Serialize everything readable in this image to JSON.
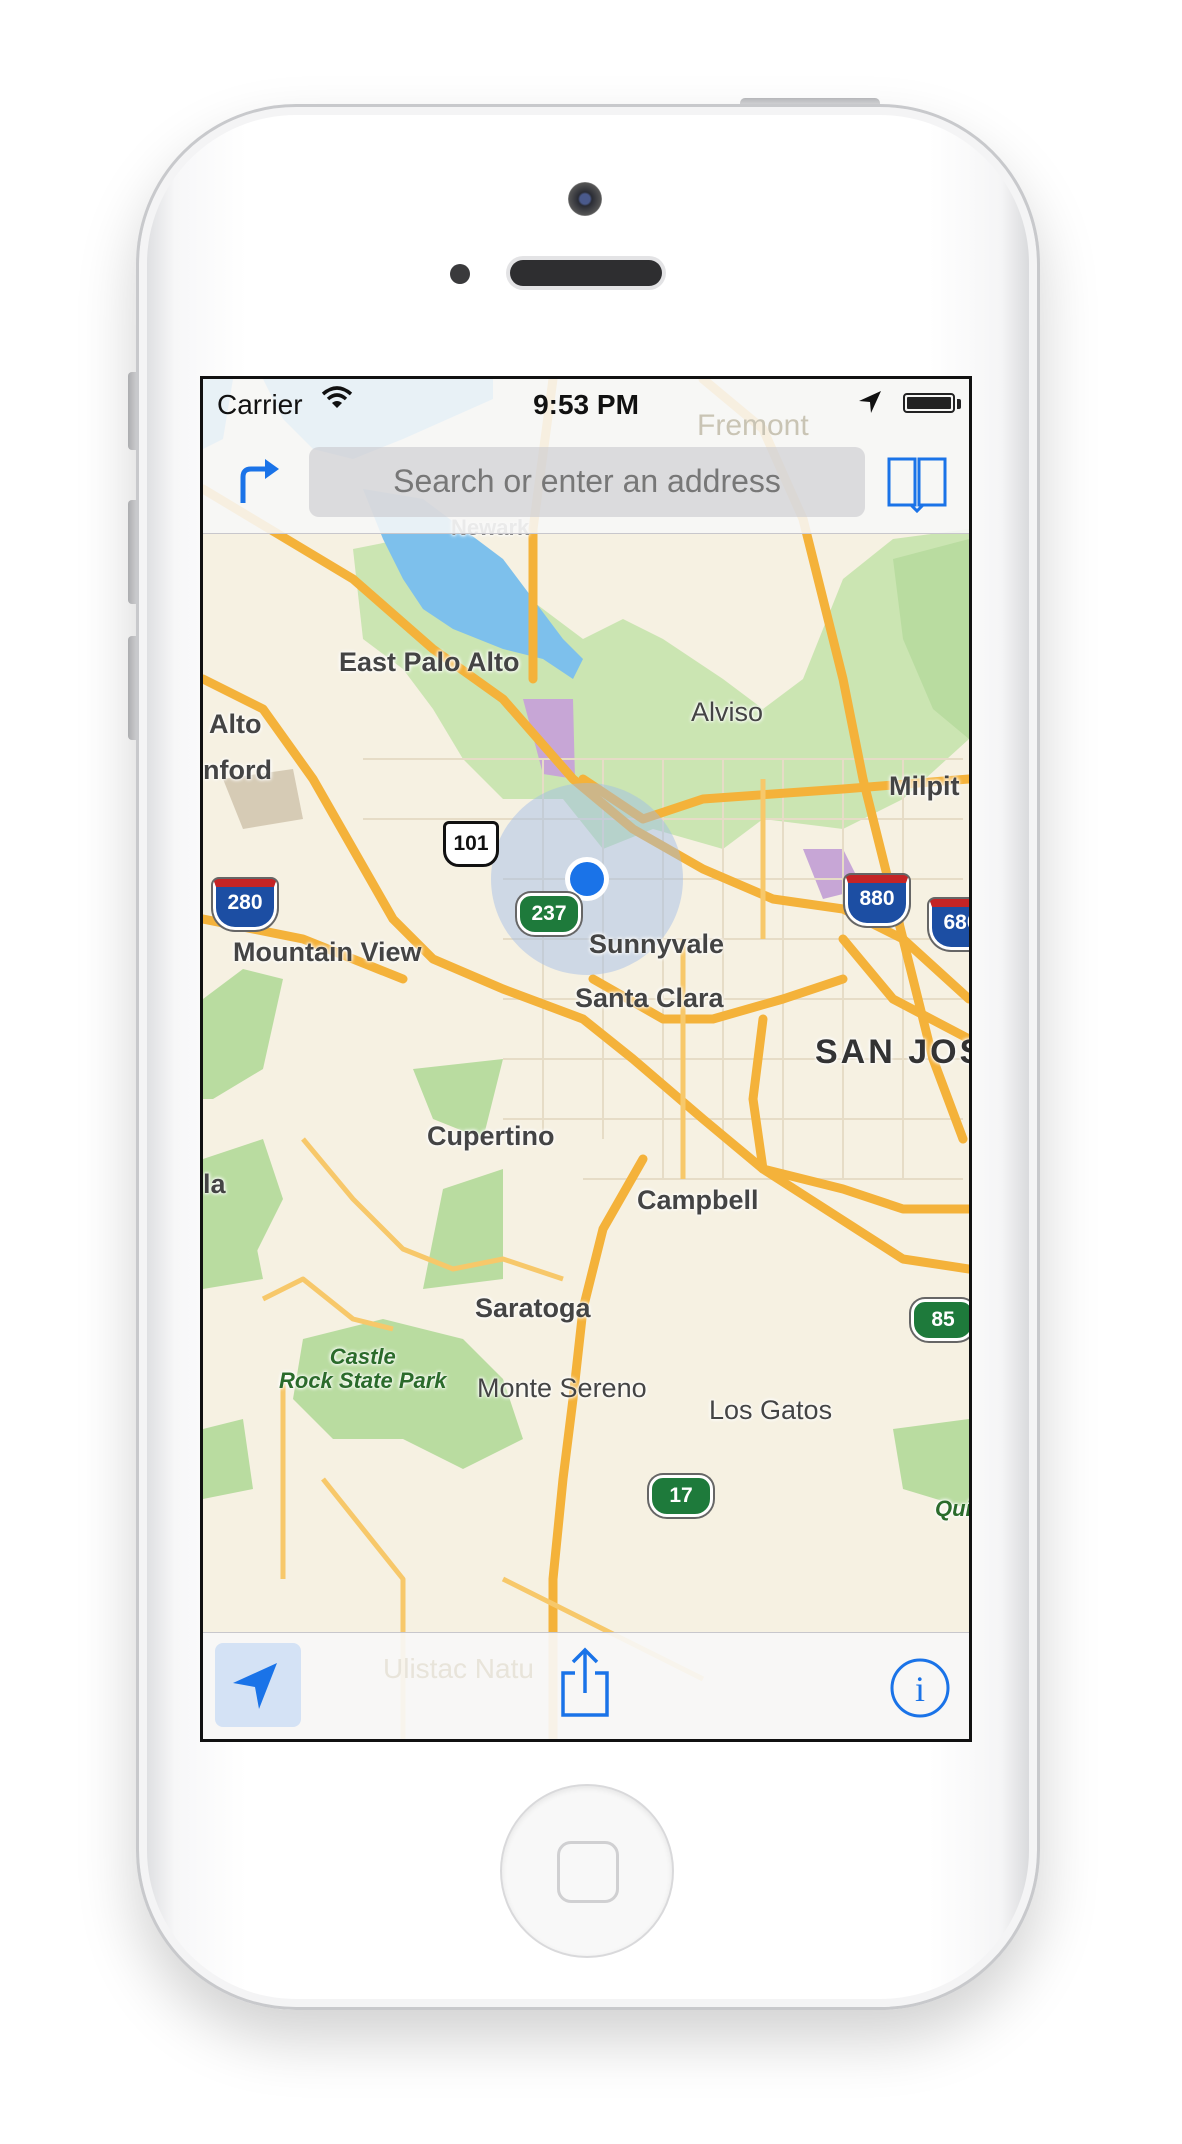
{
  "status_bar": {
    "carrier": "Carrier",
    "time": "9:53 PM",
    "battery_level_percent": 100
  },
  "nav_bar": {
    "search": {
      "placeholder": "Search or enter an address",
      "value": ""
    },
    "directions_icon": "directions-arrow-icon",
    "bookmarks_icon": "bookmarks-book-icon",
    "faded_label": "Fremont"
  },
  "map": {
    "places": [
      {
        "id": "east-palo-alto",
        "label": "East Palo Alto"
      },
      {
        "id": "palo-alto",
        "label": "Alto"
      },
      {
        "id": "stanford",
        "label": "nford"
      },
      {
        "id": "alviso",
        "label": "Alviso"
      },
      {
        "id": "milpitas",
        "label": "Milpit"
      },
      {
        "id": "mountain-view",
        "label": "Mountain View"
      },
      {
        "id": "sunnyvale",
        "label": "Sunnyvale"
      },
      {
        "id": "santa-clara",
        "label": "Santa Clara"
      },
      {
        "id": "san-jose",
        "label": "SAN JOS"
      },
      {
        "id": "cupertino",
        "label": "Cupertino"
      },
      {
        "id": "campbell",
        "label": "Campbell"
      },
      {
        "id": "saratoga",
        "label": "Saratoga"
      },
      {
        "id": "monte-sereno",
        "label": "Monte Sereno"
      },
      {
        "id": "los-gatos",
        "label": "Los Gatos"
      },
      {
        "id": "newark",
        "label": "Newark"
      },
      {
        "id": "west-edge",
        "label": "la"
      }
    ],
    "parks": [
      {
        "id": "castle-rock",
        "line1": "Castle",
        "line2": "Rock State Park"
      },
      {
        "id": "east-edge-park",
        "line1": "Qui",
        "line2": ""
      }
    ],
    "shields": [
      {
        "id": "i280",
        "type": "interstate",
        "number": "280"
      },
      {
        "id": "i880",
        "type": "interstate",
        "number": "880"
      },
      {
        "id": "i680",
        "type": "interstate",
        "number": "680"
      },
      {
        "id": "us101",
        "type": "us",
        "number": "101"
      },
      {
        "id": "sr237",
        "type": "state",
        "number": "237"
      },
      {
        "id": "sr85",
        "type": "state",
        "number": "85"
      },
      {
        "id": "sr17",
        "type": "state",
        "number": "17"
      }
    ],
    "colors": {
      "land": "#f6f1e2",
      "water": "#7dc0ec",
      "park": "#b9dca0",
      "highway": "#f4b23a",
      "user_location": "#1a73e8"
    }
  },
  "toolbar": {
    "tracking_icon": "location-arrow-icon",
    "tracking_active": true,
    "share_icon": "share-icon",
    "info_icon": "info-icon",
    "faded_label": "Ulistac Natu"
  }
}
